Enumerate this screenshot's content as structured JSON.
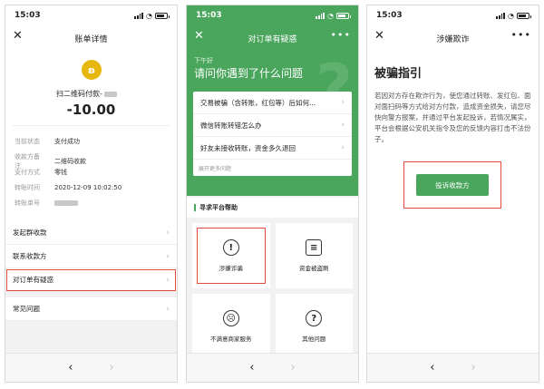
{
  "status_time": "15:03",
  "panel1": {
    "title": "账单详情",
    "merchant": "扫二维码付款-",
    "amount": "-10.00",
    "details": [
      {
        "label": "当前状态",
        "value": "支付成功"
      },
      {
        "label": "收款方备注",
        "value": "二维码收款"
      },
      {
        "label": "支付方式",
        "value": "零钱"
      },
      {
        "label": "转账时间",
        "value": "2020-12-09 10:02:50"
      },
      {
        "label": "转账单号",
        "value": ""
      }
    ],
    "menu": [
      {
        "label": "发起群收款"
      },
      {
        "label": "联系收款方"
      },
      {
        "label": "对订单有疑惑"
      },
      {
        "label": "常见问题"
      }
    ]
  },
  "panel2": {
    "title": "对订单有疑惑",
    "greeting": "下午好",
    "question_title": "请问你遇到了什么问题",
    "questions": [
      {
        "label": "交易被骗（含转账，红包等）后如何..."
      },
      {
        "label": "微信转账转错怎么办"
      },
      {
        "label": "好友未接收转账，资金多久退回"
      }
    ],
    "more_label": "展开更多问题",
    "help_title": "寻求平台帮助",
    "tiles": [
      {
        "label": "涉嫌诈骗",
        "icon": "!"
      },
      {
        "label": "资金被盗刷",
        "icon": "≡"
      },
      {
        "label": "不满意商家服务",
        "icon": "☹"
      },
      {
        "label": "其他问题",
        "icon": "?"
      }
    ]
  },
  "panel3": {
    "title": "涉嫌欺诈",
    "heading": "被骗指引",
    "body": "若因对方存在欺诈行为，使您通过转账、发红包、面对面扫码等方式给对方付款，造成资金损失，请您尽快向警方报案，并通过平台发起投诉，若情况属实，平台会根据公安机关指令及您的反馈内容打击不法份子。",
    "button": "投诉收款方"
  },
  "nav": {
    "back": "‹",
    "forward": "›"
  },
  "colors": {
    "accent_green": "#4aa55d",
    "highlight_red": "#e34b3c",
    "coin_gold": "#e8b70e"
  }
}
